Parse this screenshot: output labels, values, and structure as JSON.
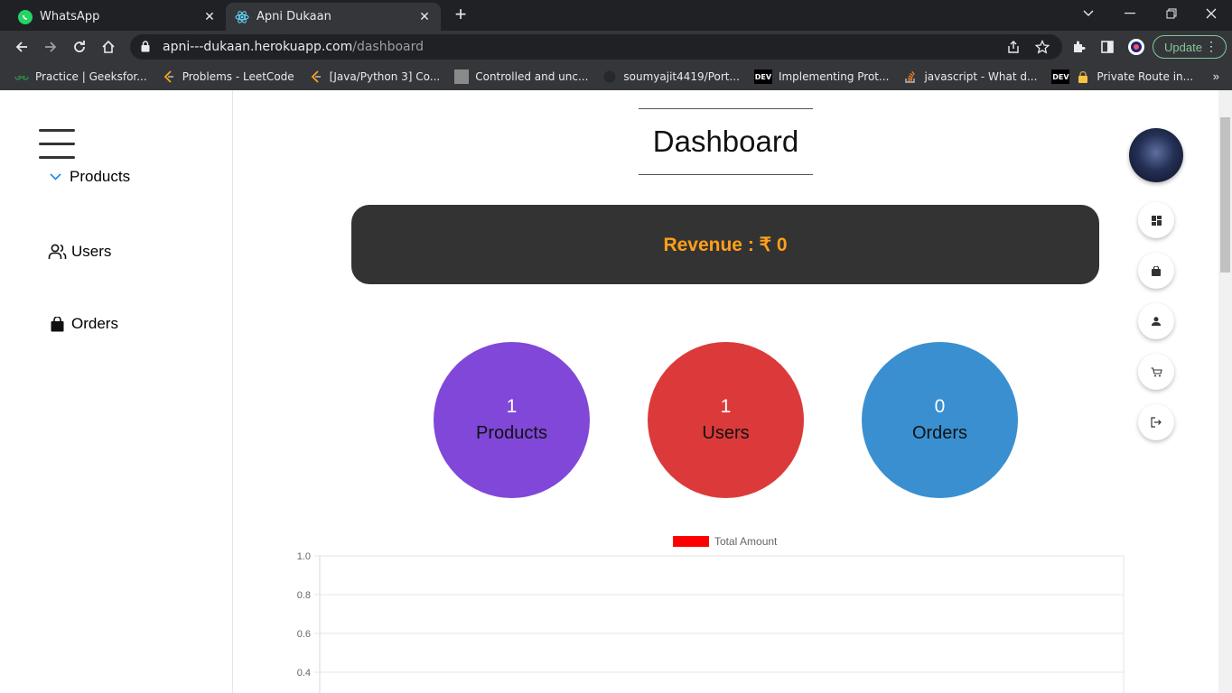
{
  "browser": {
    "tabs": [
      {
        "title": "WhatsApp",
        "icon": "whatsapp-icon"
      },
      {
        "title": "Apni Dukaan",
        "icon": "react-icon"
      }
    ],
    "url_host": "apni---dukaan.herokuapp.com",
    "url_path": "/dashboard",
    "update_label": "Update",
    "bookmarks": [
      {
        "label": "Practice | Geeksfor...",
        "icon": "geeksforgeeks-icon"
      },
      {
        "label": "Problems - LeetCode",
        "icon": "leetcode-icon"
      },
      {
        "label": "[Java/Python 3] Co...",
        "icon": "leetcode-icon"
      },
      {
        "label": "Controlled and unc...",
        "icon": "site-icon"
      },
      {
        "label": "soumyajit4419/Port...",
        "icon": "github-icon"
      },
      {
        "label": "Implementing Prot...",
        "icon": "dev-icon"
      },
      {
        "label": "javascript - What d...",
        "icon": "stackoverflow-icon"
      },
      {
        "label": "Private Route in...",
        "icon": "dev-icon"
      }
    ],
    "dev_badge": "DEV"
  },
  "sidebar": {
    "items": [
      {
        "label": "Products",
        "icon": "chevron-down-icon"
      },
      {
        "label": "Users",
        "icon": "users-icon"
      },
      {
        "label": "Orders",
        "icon": "shopping-bag-icon"
      }
    ]
  },
  "main": {
    "title": "Dashboard",
    "revenue_text": "Revenue : ₹ 0",
    "stats": [
      {
        "value": "1",
        "label": "Products",
        "color": "#8047d9"
      },
      {
        "value": "1",
        "label": "Users",
        "color": "#dc3a3a"
      },
      {
        "value": "0",
        "label": "Orders",
        "color": "#3a8fd0"
      }
    ]
  },
  "speed_dial": [
    "dashboard-icon",
    "shopping-bag-icon",
    "person-icon",
    "cart-icon",
    "logout-icon"
  ],
  "chart_data": {
    "type": "line",
    "legend": [
      "Total Amount"
    ],
    "series": [
      {
        "name": "Total Amount",
        "color": "#ff0000",
        "values": []
      }
    ],
    "ylim": [
      0,
      1.0
    ],
    "yticks": [
      "1.0",
      "0.8",
      "0.6",
      "0.4"
    ],
    "grid": true,
    "legend_position": "top"
  }
}
